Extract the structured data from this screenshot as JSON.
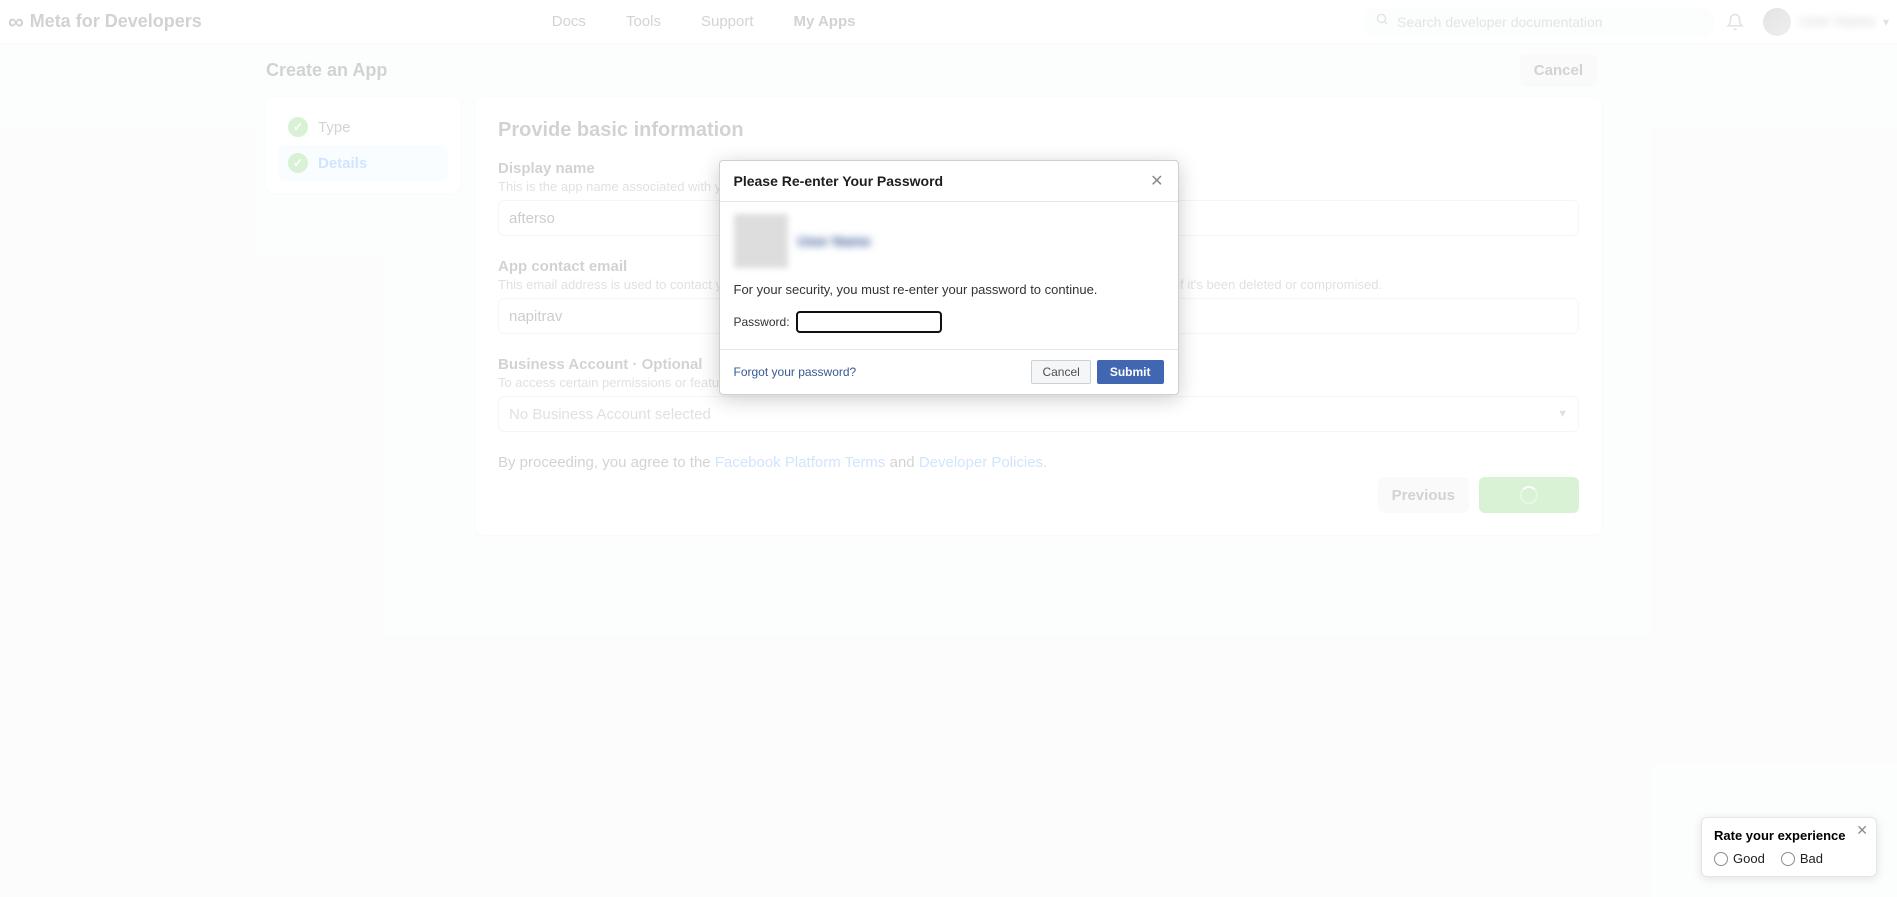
{
  "colors": {
    "primary": "#1877f2",
    "success": "#42b72a",
    "bg": "#f0f2f5"
  },
  "nav": {
    "brand": "Meta for Developers",
    "links": [
      "Docs",
      "Tools",
      "Support",
      "My Apps"
    ],
    "search_placeholder": "Search developer documentation",
    "bell_icon": "bell-icon",
    "user_name": "User Name"
  },
  "page": {
    "title": "Create an App",
    "cancel": "Cancel"
  },
  "sidebar": {
    "steps": [
      {
        "label": "Type",
        "done": true
      },
      {
        "label": "Details",
        "done": true,
        "active": true
      }
    ]
  },
  "form": {
    "heading": "Provide basic information",
    "display_name": {
      "label": "Display name",
      "desc": "This is the app name associated with your app ID. You can change this later.",
      "value": "afterso"
    },
    "contact_email": {
      "label": "App contact email",
      "desc": "This email address is used to contact you about potential policy violations, app restrictions or steps to recover the app if it's been deleted or compromised.",
      "value": "napitrav"
    },
    "business_account": {
      "label": "Business Account · Optional",
      "desc": "To access certain permissions or features, apps need to be connected to a Business Account.",
      "selected": "No Business Account selected"
    },
    "agree": {
      "pre": "By proceeding, you agree to the ",
      "terms": "Facebook Platform Terms",
      "mid": " and ",
      "policies": "Developer Policies."
    },
    "previous": "Previous"
  },
  "modal": {
    "title": "Please Re-enter Your Password",
    "user": "User Name",
    "security_text": "For your security, you must re-enter your password to continue.",
    "password_label": "Password:",
    "forgot": "Forgot your password?",
    "cancel": "Cancel",
    "submit": "Submit"
  },
  "rate": {
    "title": "Rate your experience",
    "good": "Good",
    "bad": "Bad"
  }
}
